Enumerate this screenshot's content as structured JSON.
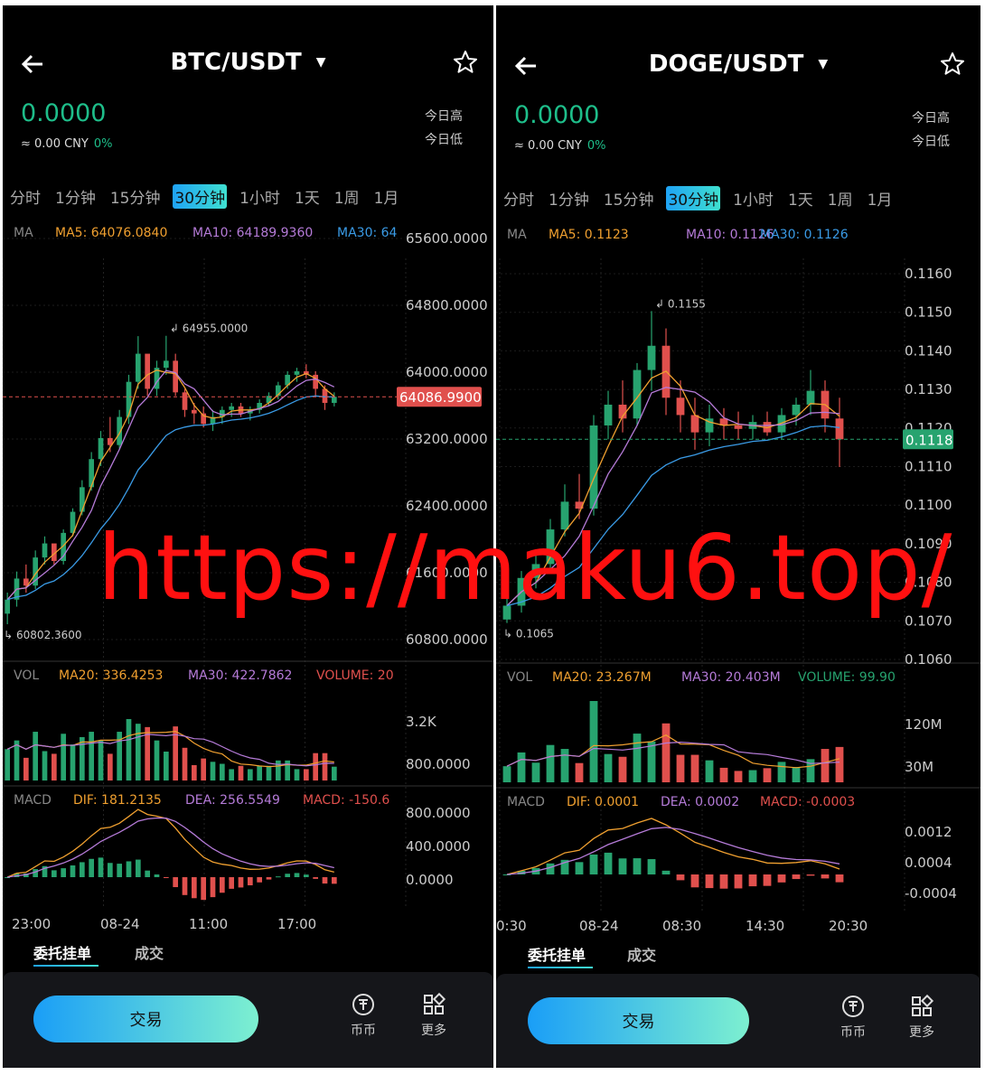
{
  "left": {
    "pair": "BTC/USDT",
    "price": "0.0000",
    "cny_value": "≈ 0.00 CNY",
    "cny_change": "0%",
    "today_high": "今日高",
    "today_low": "今日低",
    "tabs": [
      "分时",
      "1分钟",
      "15分钟",
      "30分钟",
      "1小时",
      "1天",
      "1周",
      "1月"
    ],
    "active_tab": "30分钟",
    "ma_label": "MA",
    "ma5": "MA5: 64076.0840",
    "ma10": "MA10: 64189.9360",
    "ma30": "MA30: 64",
    "price_axis": [
      "65600.0000",
      "64800.0000",
      "64000.0000",
      "63200.0000",
      "62400.0000",
      "61600.0000",
      "60800.0000"
    ],
    "current_price_tag": "64086.9900",
    "high_marker": "64955.0000",
    "low_marker": "60802.3600",
    "vol_label": "VOL",
    "vol_ma20": "MA20: 336.4253",
    "vol_ma30": "MA30: 422.7862",
    "vol_volume": "VOLUME: 20",
    "vol_axis": [
      "3.2K",
      "800.0000"
    ],
    "macd_label": "MACD",
    "dif": "DIF: 181.2135",
    "dea": "DEA: 256.5549",
    "macd": "MACD: -150.6",
    "macd_axis": [
      "800.0000",
      "400.0000",
      "0.0000"
    ],
    "time_axis": [
      "23:00",
      "08-24",
      "11:00",
      "17:00"
    ]
  },
  "right": {
    "pair": "DOGE/USDT",
    "price": "0.0000",
    "cny_value": "≈ 0.00 CNY",
    "cny_change": "0%",
    "today_high": "今日高",
    "today_low": "今日低",
    "tabs": [
      "分时",
      "1分钟",
      "15分钟",
      "30分钟",
      "1小时",
      "1天",
      "1周",
      "1月"
    ],
    "active_tab": "30分钟",
    "ma_label": "MA",
    "ma5": "MA5: 0.1123",
    "ma10": "MA10: 0.1126",
    "ma30": "MA30: 0.1126",
    "price_axis": [
      "0.1160",
      "0.1150",
      "0.1140",
      "0.1130",
      "0.1120",
      "0.1110",
      "0.1100",
      "0.1090",
      "0.1080",
      "0.1070",
      "0.1060"
    ],
    "current_price_tag": "0.1118",
    "high_marker": "0.1155",
    "low_marker": "0.1065",
    "vol_label": "VOL",
    "vol_ma20": "MA20: 23.267M",
    "vol_ma30": "MA30: 20.403M",
    "vol_volume": "VOLUME: 99.90",
    "vol_axis": [
      "120M",
      "30M"
    ],
    "macd_label": "MACD",
    "dif": "DIF: 0.0001",
    "dea": "DEA: 0.0002",
    "macd": "MACD: -0.0003",
    "macd_axis": [
      "0.0012",
      "0.0004",
      "-0.0004"
    ],
    "time_axis": [
      "0:30",
      "08-24",
      "08:30",
      "14:30",
      "20:30"
    ]
  },
  "bottom": {
    "orders_tab": "委托挂单",
    "trades_tab": "成交",
    "trade_button": "交易",
    "coin_label": "币币",
    "more_label": "更多"
  },
  "watermark": "https://maku6.top/",
  "colors": {
    "up": "#27a36f",
    "down": "#e0504d",
    "ma5": "#f0a030",
    "ma10": "#b57bd8",
    "ma30": "#3a9be6",
    "accent": "#1ebe8a"
  },
  "chart_data": [
    {
      "type": "candlestick",
      "name": "BTC/USDT",
      "ylim": [
        60400,
        65800
      ],
      "x_ticks": [
        "23:00",
        "08-24",
        "11:00",
        "17:00"
      ],
      "ohlc": [
        [
          61000,
          61300,
          60850,
          61200
        ],
        [
          61200,
          61600,
          61100,
          61500
        ],
        [
          61500,
          61700,
          61300,
          61400
        ],
        [
          61400,
          61900,
          61350,
          61800
        ],
        [
          61800,
          62100,
          61700,
          62000
        ],
        [
          62000,
          61950,
          61700,
          61750
        ],
        [
          61750,
          62200,
          61700,
          62150
        ],
        [
          62150,
          62500,
          62100,
          62450
        ],
        [
          62450,
          62900,
          62400,
          62800
        ],
        [
          62800,
          63300,
          62750,
          63200
        ],
        [
          63200,
          63600,
          63100,
          63500
        ],
        [
          63500,
          63800,
          63300,
          63400
        ],
        [
          63400,
          63900,
          63350,
          63800
        ],
        [
          63800,
          64400,
          63700,
          64300
        ],
        [
          64300,
          64950,
          64200,
          64700
        ],
        [
          64700,
          64600,
          64100,
          64200
        ],
        [
          64200,
          64600,
          64100,
          64500
        ],
        [
          64500,
          64955,
          64400,
          64600
        ],
        [
          64600,
          64700,
          64100,
          64150
        ],
        [
          64150,
          64200,
          63800,
          63900
        ],
        [
          63900,
          64000,
          63700,
          63850
        ],
        [
          63850,
          63950,
          63650,
          63700
        ],
        [
          63700,
          63900,
          63600,
          63800
        ],
        [
          63800,
          63950,
          63700,
          63900
        ],
        [
          63900,
          64000,
          63800,
          63950
        ],
        [
          63950,
          64000,
          63800,
          63850
        ],
        [
          63850,
          63950,
          63750,
          63900
        ],
        [
          63900,
          64050,
          63850,
          64000
        ],
        [
          64000,
          64150,
          63950,
          64100
        ],
        [
          64100,
          64300,
          64050,
          64250
        ],
        [
          64250,
          64450,
          64200,
          64400
        ],
        [
          64400,
          64500,
          64300,
          64450
        ],
        [
          64450,
          64550,
          64350,
          64400
        ],
        [
          64400,
          64450,
          64100,
          64200
        ],
        [
          64200,
          64250,
          63900,
          64000
        ],
        [
          64000,
          64150,
          63950,
          64087
        ]
      ]
    },
    {
      "type": "candlestick",
      "name": "DOGE/USDT",
      "ylim": [
        0.1055,
        0.1165
      ],
      "x_ticks": [
        "0:30",
        "08-24",
        "08:30",
        "14:30",
        "20:30"
      ],
      "ohlc": [
        [
          0.1066,
          0.1072,
          0.1065,
          0.107
        ],
        [
          0.107,
          0.108,
          0.1068,
          0.1078
        ],
        [
          0.1078,
          0.1085,
          0.1075,
          0.1082
        ],
        [
          0.1082,
          0.1095,
          0.108,
          0.1092
        ],
        [
          0.1092,
          0.1105,
          0.109,
          0.11
        ],
        [
          0.11,
          0.1108,
          0.1095,
          0.1098
        ],
        [
          0.1098,
          0.1125,
          0.1096,
          0.1122
        ],
        [
          0.1122,
          0.1132,
          0.1118,
          0.1128
        ],
        [
          0.1128,
          0.1135,
          0.112,
          0.1124
        ],
        [
          0.1124,
          0.114,
          0.1122,
          0.1138
        ],
        [
          0.1138,
          0.1155,
          0.1132,
          0.1145
        ],
        [
          0.1145,
          0.115,
          0.1125,
          0.113
        ],
        [
          0.113,
          0.1135,
          0.112,
          0.1125
        ],
        [
          0.1125,
          0.113,
          0.1115,
          0.112
        ],
        [
          0.112,
          0.1128,
          0.1116,
          0.1124
        ],
        [
          0.1124,
          0.1127,
          0.1118,
          0.1122
        ],
        [
          0.1122,
          0.1126,
          0.1118,
          0.1121
        ],
        [
          0.1121,
          0.1125,
          0.1118,
          0.1123
        ],
        [
          0.1123,
          0.1126,
          0.1119,
          0.112
        ],
        [
          0.112,
          0.1127,
          0.1118,
          0.1125
        ],
        [
          0.1125,
          0.113,
          0.1122,
          0.1128
        ],
        [
          0.1128,
          0.1138,
          0.1125,
          0.1132
        ],
        [
          0.1132,
          0.1135,
          0.112,
          0.1124
        ],
        [
          0.1124,
          0.113,
          0.111,
          0.1118
        ]
      ]
    }
  ]
}
